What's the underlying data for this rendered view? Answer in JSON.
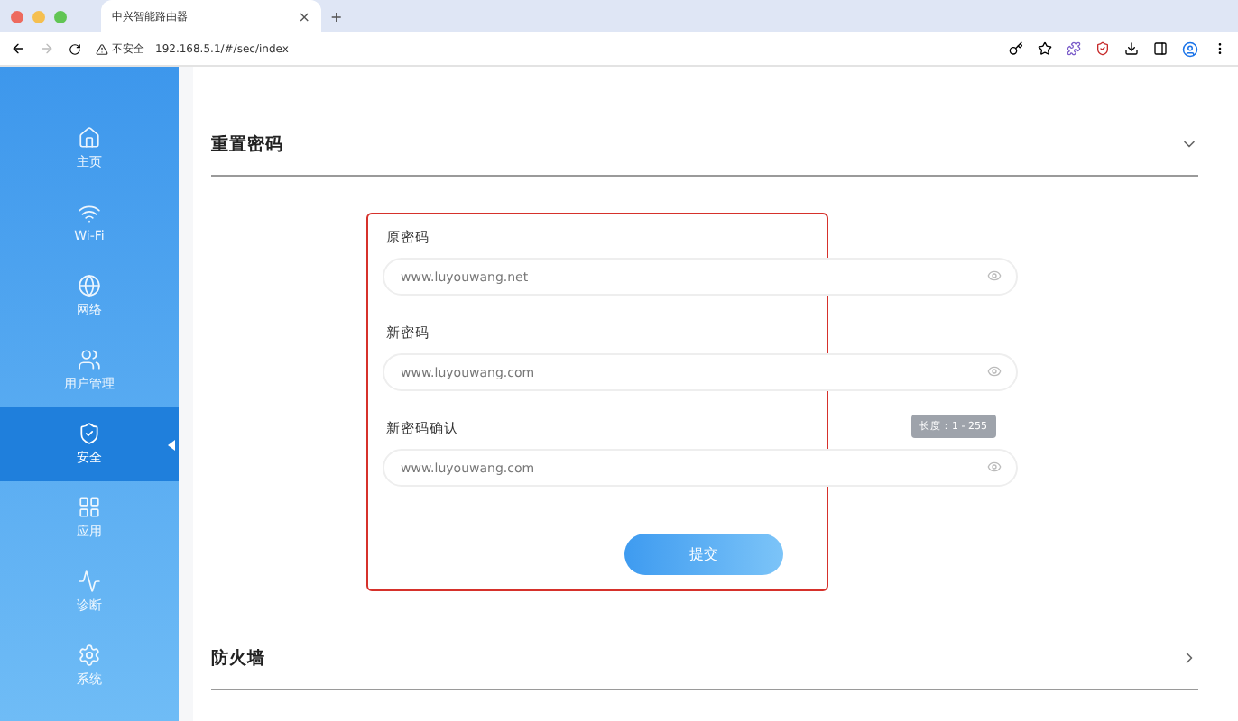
{
  "browser": {
    "tab_title": "中兴智能路由器",
    "tab_close": "×",
    "new_tab": "+",
    "security": "不安全",
    "url": "192.168.5.1/#/sec/index"
  },
  "sidebar": {
    "items": [
      {
        "label": "主页",
        "selected": false
      },
      {
        "label": "Wi-Fi",
        "selected": false
      },
      {
        "label": "网络",
        "selected": false
      },
      {
        "label": "用户管理",
        "selected": false
      },
      {
        "label": "安全",
        "selected": true
      },
      {
        "label": "应用",
        "selected": false
      },
      {
        "label": "诊断",
        "selected": false
      },
      {
        "label": "系统",
        "selected": false
      }
    ]
  },
  "sections": [
    {
      "title": "重置密码",
      "expanded": true,
      "fields": [
        {
          "label": "原密码",
          "placeholder": "www.luyouwang.net"
        },
        {
          "label": "新密码",
          "placeholder": "www.luyouwang.com"
        },
        {
          "label": "新密码确认",
          "placeholder": "www.luyouwang.com",
          "tooltip": "长度：1 - 255"
        }
      ],
      "submit": "提交"
    },
    {
      "title": "防火墙",
      "expanded": false
    }
  ]
}
